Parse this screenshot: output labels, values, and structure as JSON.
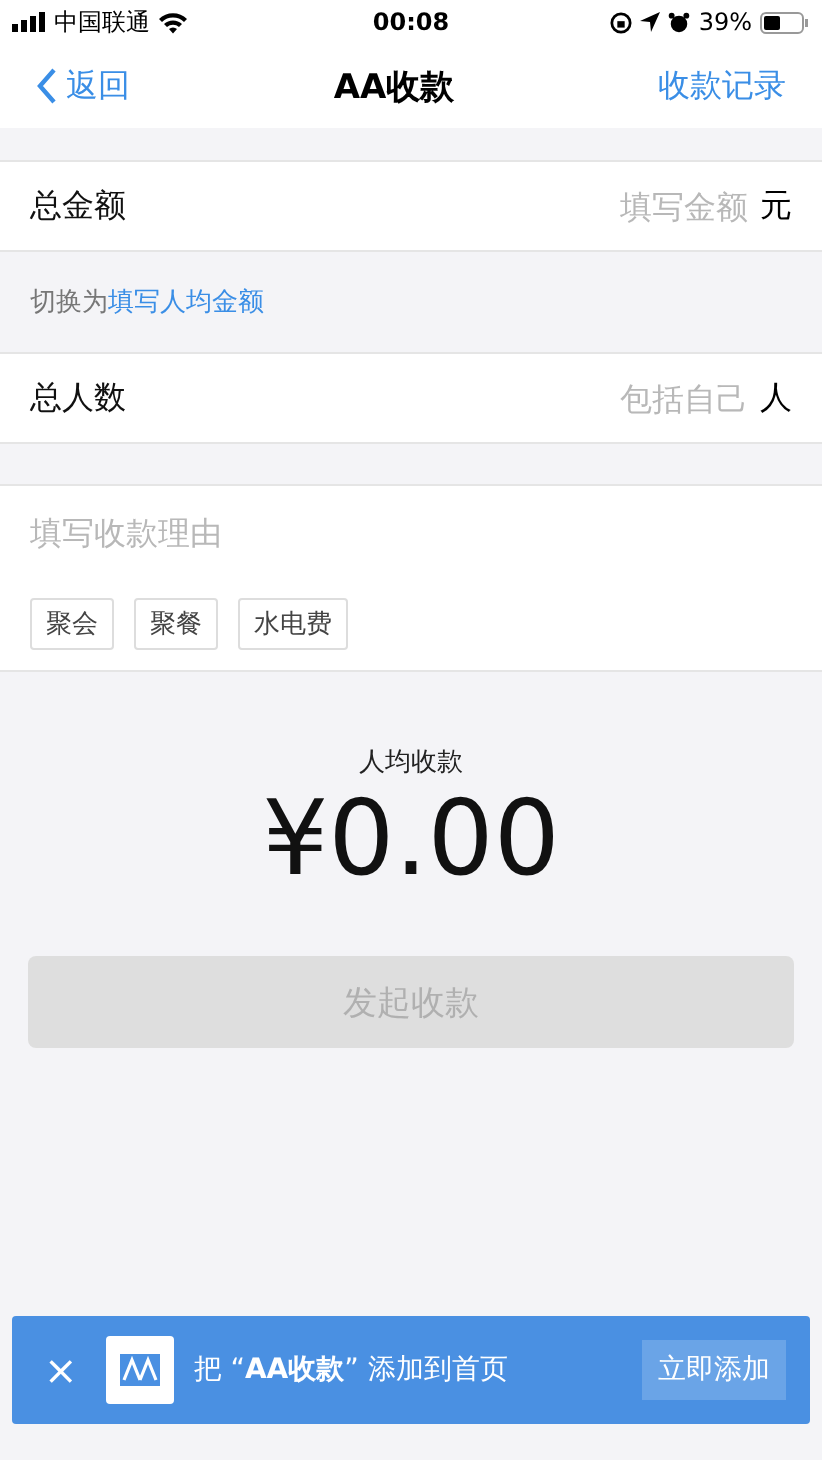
{
  "status_bar": {
    "carrier": "中国联通",
    "time": "00:08",
    "battery": "39%"
  },
  "nav": {
    "back": "返回",
    "title": "AA收款",
    "action": "收款记录"
  },
  "total_amount": {
    "label": "总金额",
    "placeholder": "填写金额",
    "unit": "元"
  },
  "switch_hint": {
    "prefix": "切换为",
    "link": "填写人均金额"
  },
  "people": {
    "label": "总人数",
    "placeholder": "包括自己",
    "unit": "人"
  },
  "reason": {
    "placeholder": "填写收款理由",
    "tags": [
      "聚会",
      "聚餐",
      "水电费"
    ]
  },
  "per_person": {
    "label": "人均收款",
    "amount": "¥0.00"
  },
  "submit": {
    "label": "发起收款",
    "disabled": true
  },
  "banner": {
    "close": "×",
    "text": "把 “**AA收款**” 添加到首页",
    "button": "立即添加"
  }
}
